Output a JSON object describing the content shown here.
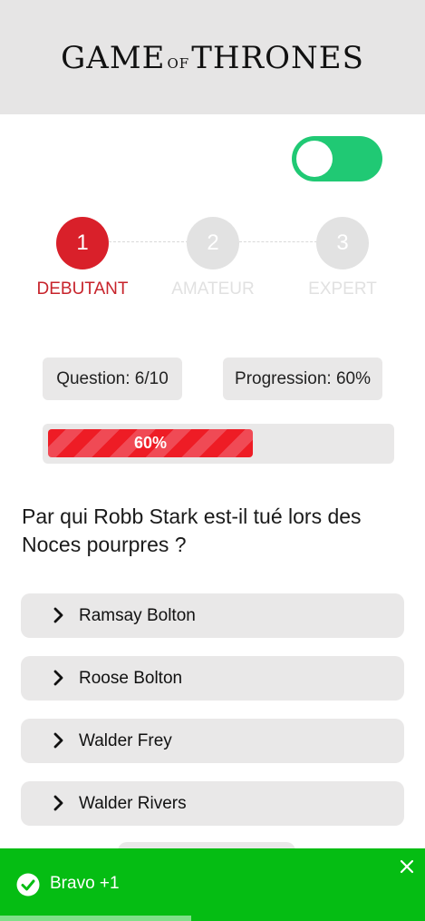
{
  "header": {
    "logo_part1": "GAME",
    "logo_part2": "OF",
    "logo_part3": "THRONES"
  },
  "toggle": {
    "state": "on",
    "color": "#20c974"
  },
  "steps": [
    {
      "number": "1",
      "label": "DEBUTANT",
      "active": true,
      "color": "#d9202a"
    },
    {
      "number": "2",
      "label": "AMATEUR",
      "active": false,
      "color": "#e2e2e2"
    },
    {
      "number": "3",
      "label": "EXPERT",
      "active": false,
      "color": "#e2e2e2"
    }
  ],
  "stats": {
    "question": "Question: 6/10",
    "progression": "Progression: 60%"
  },
  "progress": {
    "percent": 60,
    "label": "60%"
  },
  "quiz": {
    "question": "Par qui Robb Stark est-il tué lors des Noces pourpres ?",
    "answers": [
      {
        "label": "Ramsay Bolton"
      },
      {
        "label": "Roose Bolton"
      },
      {
        "label": "Walder Frey"
      },
      {
        "label": "Walder Rivers"
      }
    ]
  },
  "toast": {
    "message": "Bravo +1",
    "color": "#05bd13",
    "timer_remaining": 0.45
  }
}
